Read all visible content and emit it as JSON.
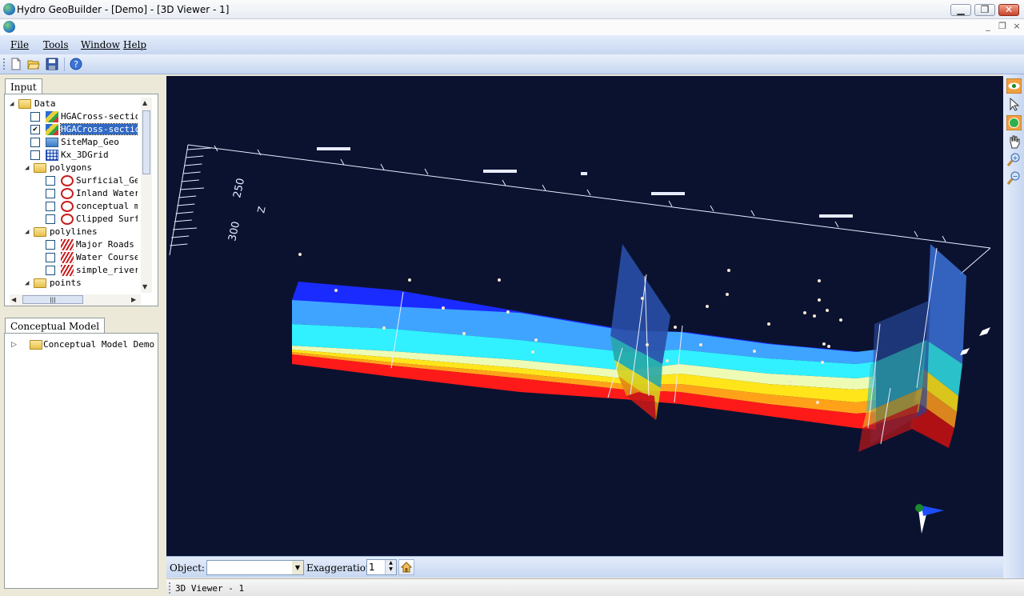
{
  "window": {
    "title": "Hydro GeoBuilder - [Demo] - [3D Viewer - 1]",
    "minimize": "▁",
    "maximize": "❐",
    "close": "✕",
    "mdi_minimize": "_",
    "mdi_restore": "❐",
    "mdi_close": "×"
  },
  "menu": [
    "File",
    "Tools",
    "Window",
    "Help"
  ],
  "toolbar": [
    "new-file-icon",
    "open-folder-icon",
    "save-icon",
    "help-icon"
  ],
  "input_panel": {
    "tab": "Input",
    "tree": [
      {
        "label": "Data",
        "type": "folder",
        "level": 0,
        "expanded": true
      },
      {
        "label": "HGACross-sections",
        "type": "layer",
        "level": 1,
        "checked": false
      },
      {
        "label": "HGACross-sections",
        "type": "layer",
        "level": 1,
        "checked": true,
        "selected": true
      },
      {
        "label": "SiteMap_Geo",
        "type": "map",
        "level": 1,
        "checked": false
      },
      {
        "label": "Kx_3DGrid",
        "type": "grid",
        "level": 1,
        "checked": false
      },
      {
        "label": "polygons",
        "type": "folder",
        "level": 1,
        "expanded": true
      },
      {
        "label": "Surficial_Geol",
        "type": "polygon",
        "level": 2,
        "checked": false
      },
      {
        "label": "Inland Water B",
        "type": "polygon",
        "level": 2,
        "checked": false
      },
      {
        "label": "conceptual mod",
        "type": "polygon",
        "level": 2,
        "checked": false
      },
      {
        "label": "Clipped Surfic",
        "type": "polygon",
        "level": 2,
        "checked": false
      },
      {
        "label": "polylines",
        "type": "folder",
        "level": 1,
        "expanded": true
      },
      {
        "label": "Major Roads",
        "type": "polyline",
        "level": 2,
        "checked": false
      },
      {
        "label": "Water Courses",
        "type": "polyline",
        "level": 2,
        "checked": false
      },
      {
        "label": "simple_river",
        "type": "polyline",
        "level": 2,
        "checked": false
      },
      {
        "label": "points",
        "type": "folder",
        "level": 1,
        "expanded": true
      }
    ],
    "scroll_thumb": "|||"
  },
  "conceptual_panel": {
    "tab": "Conceptual Model",
    "tree": [
      {
        "label": "Conceptual Model Demo",
        "type": "folder",
        "level": 0,
        "expanded": false
      }
    ]
  },
  "viewer": {
    "axis_labels": {
      "z": "Z",
      "tick_250": "250",
      "tick_300": "300"
    },
    "colors": {
      "background": "#0b1230",
      "layer_blue": "#1a2bff",
      "layer_lightblue": "#3fa4ff",
      "layer_cyan": "#31f0ff",
      "layer_pale": "#eefbb5",
      "layer_yellow": "#ffe51a",
      "layer_orange": "#ffa21a",
      "layer_red": "#ff1a1a"
    }
  },
  "right_toolbar": [
    "eye-view-icon",
    "pointer-icon",
    "rotate-icon",
    "pan-hand-icon",
    "zoom-in-icon",
    "zoom-out-icon"
  ],
  "viewer_bar": {
    "object_label": "Object:",
    "object_value": "",
    "exaggeration_label": "Exaggeration",
    "exaggeration_value": "1"
  },
  "status": {
    "text": "3D Viewer - 1"
  }
}
